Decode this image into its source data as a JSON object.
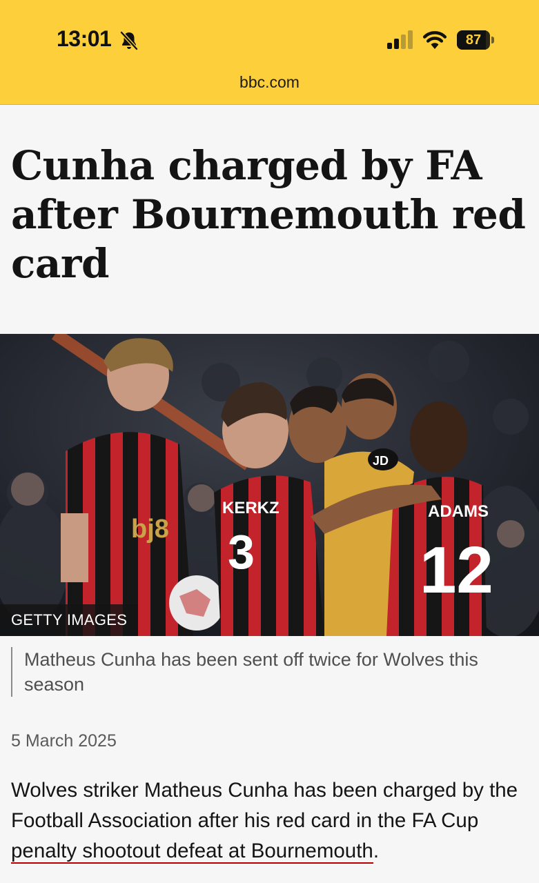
{
  "status_bar": {
    "time": "13:01",
    "battery_level": 87,
    "icons": [
      "bell-slash-icon",
      "cellular-signal-icon",
      "wifi-icon",
      "battery-icon"
    ]
  },
  "browser": {
    "url": "bbc.com"
  },
  "colors": {
    "status_bar_bg": "#fdcf3a",
    "link_underline": "#b80000",
    "page_bg": "#f6f6f6"
  },
  "article": {
    "headline": "Cunha charged by FA after Bournemouth red card",
    "image": {
      "credit": "GETTY IMAGES",
      "caption": "Matheus Cunha has been sent off twice for Wolves this season"
    },
    "date": "5 March 2025",
    "paragraph": {
      "text_before": "Wolves striker Matheus Cunha has been charged by the Football Association after his red card in the FA Cup ",
      "link_text": "penalty shootout defeat at Bournemouth",
      "text_after": "."
    }
  }
}
